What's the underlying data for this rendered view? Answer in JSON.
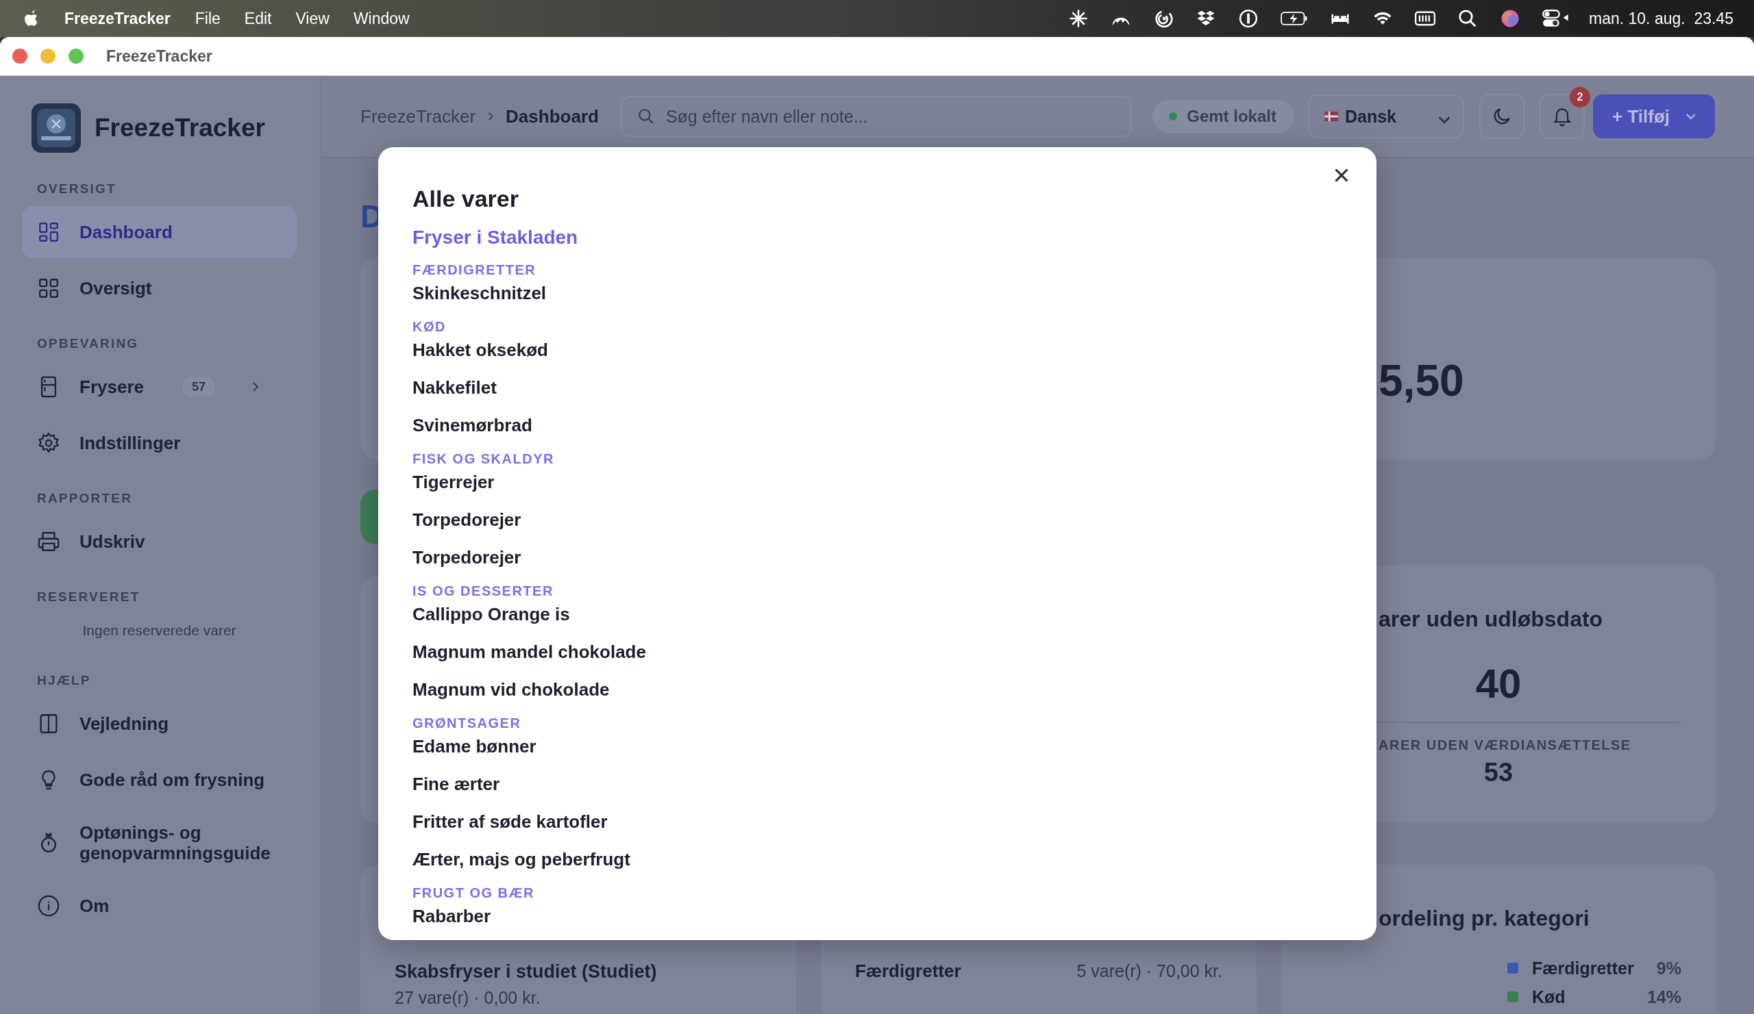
{
  "menu_bar": {
    "app_name": "FreezeTracker",
    "menus": [
      "File",
      "Edit",
      "View",
      "Window"
    ],
    "clock": "man. 10. aug.  23.45"
  },
  "window": {
    "title": "FreezeTracker"
  },
  "sidebar": {
    "app_name": "FreezeTracker",
    "sections": [
      {
        "heading": "OVERSIGT",
        "items": [
          {
            "label": "Dashboard",
            "selected": true
          },
          {
            "label": "Oversigt",
            "selected": false
          }
        ]
      },
      {
        "heading": "OPBEVARING",
        "items": [
          {
            "label": "Frysere",
            "selected": false,
            "badge": "57",
            "expanded": false
          },
          {
            "label": "Indstillinger",
            "selected": false
          }
        ]
      },
      {
        "heading": "RAPPORTER",
        "items": [
          {
            "label": "Udskriv",
            "selected": false
          }
        ]
      },
      {
        "heading": "RESERVERET",
        "empty_text": "Ingen reserverede varer"
      },
      {
        "heading": "HJÆLP",
        "items": [
          {
            "label": "Vejledning",
            "selected": false
          },
          {
            "label": "Gode råd om frysning",
            "selected": false
          },
          {
            "label": "Optønings- og genopvarmningsguide",
            "selected": false
          },
          {
            "label": "Om",
            "selected": false
          }
        ]
      }
    ]
  },
  "header": {
    "breadcrumb": [
      "FreezeTracker",
      "Dashboard"
    ],
    "search": {
      "placeholder": "Søg efter navn eller note..."
    },
    "save_status": "Gemt lokalt",
    "language": "Dansk",
    "notification_count": "2",
    "add_button": "+ Tilføj"
  },
  "dashboard": {
    "heading": "D",
    "total_value": "5,50",
    "no_expiry_title": "arer uden udløbsdato",
    "no_expiry_count": "40",
    "no_value_label": "ARER UDEN VÆRDIANSÆTTELSE",
    "no_value_count": "53",
    "category_title": "ordeling pr. kategori",
    "legend": [
      {
        "label": "Færdigretter",
        "value": "9%",
        "color": "#3a58b0"
      },
      {
        "label": "Kød",
        "value": "14%",
        "color": "#3c7d52"
      }
    ],
    "freezer": {
      "name": "Skabsfryser i studiet (Studiet)",
      "summary": "27 vare(r) · 0,00 kr."
    },
    "category_row": {
      "name": "Færdigretter",
      "summary": "5 vare(r) · 70,00 kr."
    }
  },
  "modal": {
    "title": "Alle varer",
    "freezer": "Fryser i Stakladen",
    "groups": [
      {
        "category": "FÆRDIGRETTER",
        "items": [
          "Skinkeschnitzel"
        ]
      },
      {
        "category": "KØD",
        "items": [
          "Hakket oksekød",
          "Nakkefilet",
          "Svinemørbrad"
        ]
      },
      {
        "category": "FISK OG SKALDYR",
        "items": [
          "Tigerrejer",
          "Torpedorejer",
          "Torpedorejer"
        ]
      },
      {
        "category": "IS OG DESSERTER",
        "items": [
          "Callippo Orange is",
          "Magnum mandel chokolade",
          "Magnum vid chokolade"
        ]
      },
      {
        "category": "GRØNTSAGER",
        "items": [
          "Edame bønner",
          "Fine ærter",
          "Fritter af søde kartofler",
          "Ærter, majs og peberfrugt"
        ]
      },
      {
        "category": "FRUGT OG BÆR",
        "items": [
          "Rabarber"
        ]
      }
    ]
  }
}
